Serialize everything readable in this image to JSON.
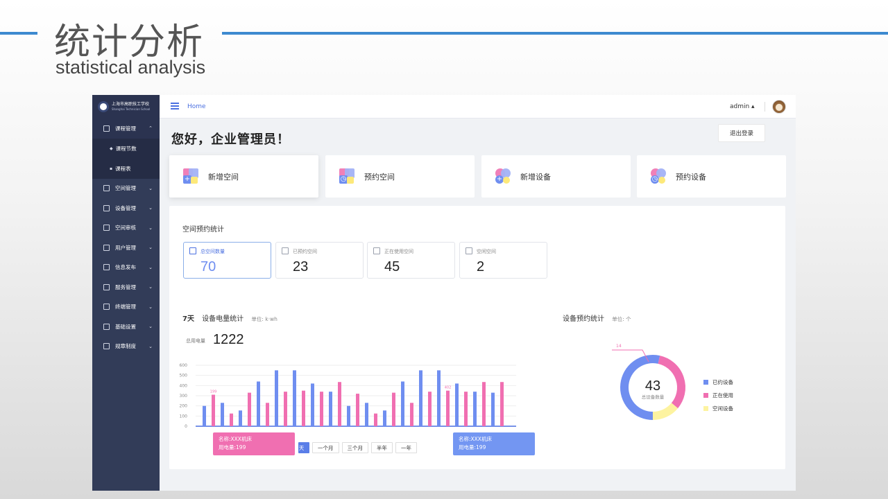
{
  "slide": {
    "title": "统计分析",
    "subtitle": "statistical analysis"
  },
  "logo": {
    "cn": "上海市高职技工学校",
    "en": "Shanghai Technician School"
  },
  "sidebar": {
    "items": [
      {
        "label": "课程管理",
        "open": true
      },
      {
        "label": "空间管理"
      },
      {
        "label": "设备管理"
      },
      {
        "label": "空间审核"
      },
      {
        "label": "用户管理"
      },
      {
        "label": "信息发布"
      },
      {
        "label": "服务管理"
      },
      {
        "label": "终端管理"
      },
      {
        "label": "基础设置"
      },
      {
        "label": "规章制度"
      }
    ],
    "subitems": [
      {
        "label": "课程节数"
      },
      {
        "label": "课程表"
      }
    ]
  },
  "topbar": {
    "breadcrumb": "Home",
    "user": "admin ▴"
  },
  "greeting": "您好，企业管理员！",
  "logout_label": "退出登录",
  "quick_actions": [
    {
      "label": "新增空间"
    },
    {
      "label": "预约空间"
    },
    {
      "label": "新增设备"
    },
    {
      "label": "预约设备"
    }
  ],
  "space_stats": {
    "title": "空间预约统计",
    "cards": [
      {
        "label": "总空间数量",
        "value": "70"
      },
      {
        "label": "已预约空间",
        "value": "23"
      },
      {
        "label": "正在使用空间",
        "value": "45"
      },
      {
        "label": "空闲空间",
        "value": "2"
      }
    ]
  },
  "power": {
    "days_label": "7天",
    "title": "设备电量统计",
    "unit": "单位: k·wh",
    "total_label": "总用电量",
    "total_value": "1222",
    "tooltip_name": "名称:XXX机床",
    "tooltip_usage": "用电量:199",
    "range_buttons": [
      "天",
      "一个月",
      "三个月",
      "半年",
      "一年"
    ]
  },
  "device_stats": {
    "title": "设备预约统计",
    "unit": "单位: 个",
    "center_value": "43",
    "center_label": "总设备数量",
    "callout": "14",
    "legend": [
      "已约设备",
      "正在使用",
      "空闲设备"
    ]
  },
  "colors": {
    "blue": "#6f8ef0",
    "pink": "#f06fb1",
    "yellow": "#fdf3a0",
    "accent": "#3d8ad0"
  },
  "chart_data": [
    {
      "type": "bar",
      "title": "设备电量统计",
      "ylabel": "单位: k·wh",
      "ylim": [
        0,
        600
      ],
      "yticks": [
        0,
        100,
        200,
        300,
        400,
        500,
        600
      ],
      "series": [
        {
          "values": [
            200,
            310,
            230,
            125,
            155,
            330,
            440,
            230,
            550,
            340,
            550,
            350,
            420,
            340,
            340,
            435,
            200,
            320,
            230,
            125,
            155,
            330,
            440,
            230,
            550,
            340,
            550,
            350,
            420,
            340,
            340,
            435,
            330,
            435
          ]
        }
      ],
      "data_labels": [
        {
          "index": 1,
          "text": "199"
        },
        {
          "index": 27,
          "text": "402"
        }
      ]
    },
    {
      "type": "pie",
      "title": "设备预约统计",
      "slices": [
        {
          "name": "已约设备",
          "value": 23
        },
        {
          "name": "正在使用",
          "value": 14
        },
        {
          "name": "空闲设备",
          "value": 6
        }
      ]
    }
  ]
}
